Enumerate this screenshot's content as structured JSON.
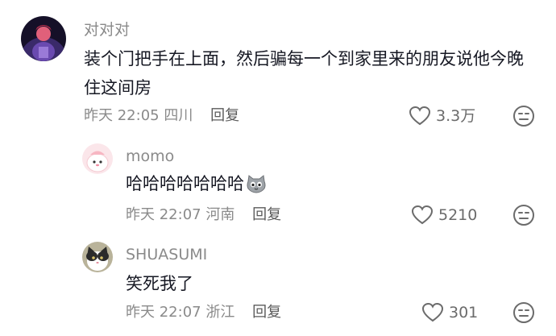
{
  "comments": [
    {
      "username": "对对对",
      "text": "装个门把手在上面，然后骗每一个到家里来的朋友说他今晚住这间房",
      "time": "昨天 22:05",
      "location": "四川",
      "reply_label": "回复",
      "likes": "3.3万",
      "avatar_icon": "user-avatar-dark",
      "like_icon": "heart-outline-icon",
      "dislike_icon": "unamused-face-icon"
    },
    {
      "username": "momo",
      "text": "哈哈哈哈哈哈哈",
      "text_emoji": "cat-face-emoji",
      "time": "昨天 22:07",
      "location": "河南",
      "reply_label": "回复",
      "likes": "5210",
      "avatar_icon": "user-avatar-pink",
      "like_icon": "heart-outline-icon",
      "dislike_icon": "unamused-face-icon"
    },
    {
      "username": "SHUASUMI",
      "text": "笑死我了",
      "time": "昨天 22:07",
      "location": "浙江",
      "reply_label": "回复",
      "likes": "301",
      "avatar_icon": "user-avatar-cat",
      "like_icon": "heart-outline-icon",
      "dislike_icon": "unamused-face-icon"
    }
  ],
  "colors": {
    "username": "#8a8a8a",
    "text": "#161823",
    "meta": "#8a8a8a",
    "icon": "#6b6b6b"
  }
}
